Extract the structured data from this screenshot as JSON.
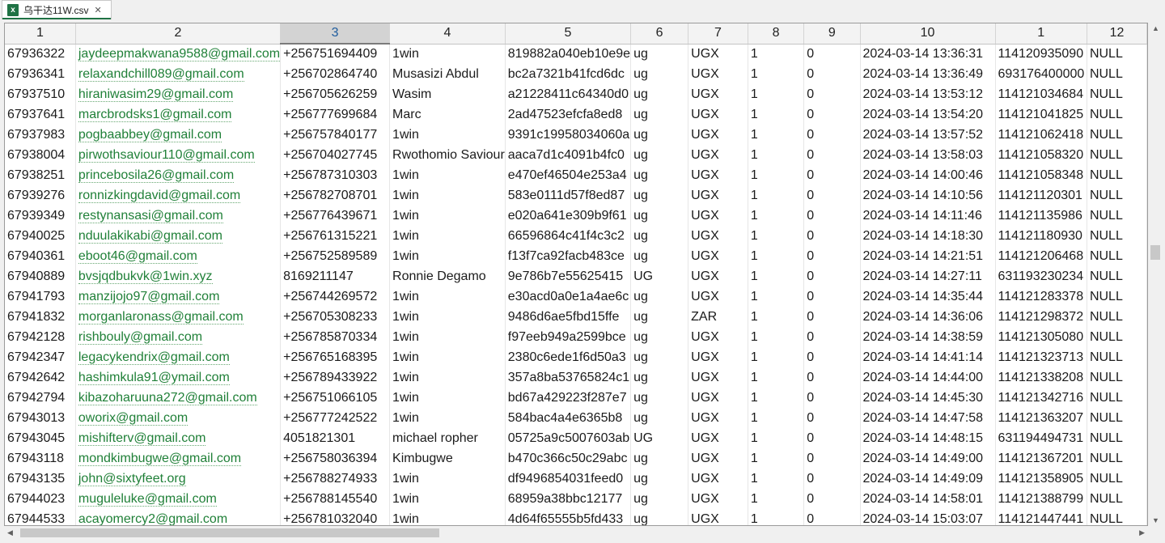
{
  "tab": {
    "title": "乌干达11W.csv",
    "icon": "x",
    "close": "✕"
  },
  "columns": [
    "1",
    "2",
    "3",
    "4",
    "5",
    "6",
    "7",
    "8",
    "9",
    "10",
    "1",
    "12"
  ],
  "rows": [
    [
      "67936322",
      "jaydeepmakwana9588@gmail.com",
      "+256751694409",
      "1win",
      "819882a040eb10e9e",
      "ug",
      "UGX",
      "1",
      "0",
      "2024-03-14 13:36:31",
      "114120935090",
      "NULL"
    ],
    [
      "67936341",
      "relaxandchill089@gmail.com",
      "+256702864740",
      "Musasizi Abdul",
      "bc2a7321b41fcd6dc",
      "ug",
      "UGX",
      "1",
      "0",
      "2024-03-14 13:36:49",
      "693176400000",
      "NULL"
    ],
    [
      "67937510",
      "hiraniwasim29@gmail.com",
      "+256705626259",
      "Wasim",
      "a21228411c64340d0",
      "ug",
      "UGX",
      "1",
      "0",
      "2024-03-14 13:53:12",
      "114121034684",
      "NULL"
    ],
    [
      "67937641",
      "marcbrodsks1@gmail.com",
      "+256777699684",
      "Marc",
      "2ad47523efcfa8ed8",
      "ug",
      "UGX",
      "1",
      "0",
      "2024-03-14 13:54:20",
      "114121041825",
      "NULL"
    ],
    [
      "67937983",
      "pogbaabbey@gmail.com",
      "+256757840177",
      "1win",
      "9391c19958034060a",
      "ug",
      "UGX",
      "1",
      "0",
      "2024-03-14 13:57:52",
      "114121062418",
      "NULL"
    ],
    [
      "67938004",
      "pirwothsaviour110@gmail.com",
      "+256704027745",
      "Rwothomio Saviour",
      "aaca7d1c4091b4fc0",
      "ug",
      "UGX",
      "1",
      "0",
      "2024-03-14 13:58:03",
      "114121058320",
      "NULL"
    ],
    [
      "67938251",
      "princebosila26@gmail.com",
      "+256787310303",
      "1win",
      "e470ef46504e253a4",
      "ug",
      "UGX",
      "1",
      "0",
      "2024-03-14 14:00:46",
      "114121058348",
      "NULL"
    ],
    [
      "67939276",
      "ronnizkingdavid@gmail.com",
      "+256782708701",
      "1win",
      "583e0111d57f8ed87",
      "ug",
      "UGX",
      "1",
      "0",
      "2024-03-14 14:10:56",
      "114121120301",
      "NULL"
    ],
    [
      "67939349",
      "restynansasi@gmail.com",
      "+256776439671",
      "1win",
      "e020a641e309b9f61",
      "ug",
      "UGX",
      "1",
      "0",
      "2024-03-14 14:11:46",
      "114121135986",
      "NULL"
    ],
    [
      "67940025",
      "nduulakikabi@gmail.com",
      "+256761315221",
      "1win",
      "66596864c41f4c3c2",
      "ug",
      "UGX",
      "1",
      "0",
      "2024-03-14 14:18:30",
      "114121180930",
      "NULL"
    ],
    [
      "67940361",
      "eboot46@gmail.com",
      "+256752589589",
      "1win",
      "f13f7ca92facb483ce",
      "ug",
      "UGX",
      "1",
      "0",
      "2024-03-14 14:21:51",
      "114121206468",
      "NULL"
    ],
    [
      "67940889",
      "bvsjqdbukvk@1win.xyz",
      "8169211147",
      "Ronnie Degamo",
      "9e786b7e55625415",
      "UG",
      "UGX",
      "1",
      "0",
      "2024-03-14 14:27:11",
      "631193230234",
      "NULL"
    ],
    [
      "67941793",
      "manzijojo97@gmail.com",
      "+256744269572",
      "1win",
      "e30acd0a0e1a4ae6c",
      "ug",
      "UGX",
      "1",
      "0",
      "2024-03-14 14:35:44",
      "114121283378",
      "NULL"
    ],
    [
      "67941832",
      "morganlaronass@gmail.com",
      "+256705308233",
      "1win",
      "9486d6ae5fbd15ffe",
      "ug",
      "ZAR",
      "1",
      "0",
      "2024-03-14 14:36:06",
      "114121298372",
      "NULL"
    ],
    [
      "67942128",
      "rishbouly@gmail.com",
      "+256785870334",
      "1win",
      "f97eeb949a2599bce",
      "ug",
      "UGX",
      "1",
      "0",
      "2024-03-14 14:38:59",
      "114121305080",
      "NULL"
    ],
    [
      "67942347",
      "legacykendrix@gmail.com",
      "+256765168395",
      "1win",
      "2380c6ede1f6d50a3",
      "ug",
      "UGX",
      "1",
      "0",
      "2024-03-14 14:41:14",
      "114121323713",
      "NULL"
    ],
    [
      "67942642",
      "hashimkula91@ymail.com",
      "+256789433922",
      "1win",
      "357a8ba53765824c1",
      "ug",
      "UGX",
      "1",
      "0",
      "2024-03-14 14:44:00",
      "114121338208",
      "NULL"
    ],
    [
      "67942794",
      "kibazoharuuna272@gmail.com",
      "+256751066105",
      "1win",
      "bd67a429223f287e7",
      "ug",
      "UGX",
      "1",
      "0",
      "2024-03-14 14:45:30",
      "114121342716",
      "NULL"
    ],
    [
      "67943013",
      "oworix@gmail.com",
      "+256777242522",
      "1win",
      "584bac4a4e6365b8",
      "ug",
      "UGX",
      "1",
      "0",
      "2024-03-14 14:47:58",
      "114121363207",
      "NULL"
    ],
    [
      "67943045",
      "mishifterv@gmail.com",
      "4051821301",
      "michael ropher",
      "05725a9c5007603ab",
      "UG",
      "UGX",
      "1",
      "0",
      "2024-03-14 14:48:15",
      "631194494731",
      "NULL"
    ],
    [
      "67943118",
      "mondkimbugwe@gmail.com",
      "+256758036394",
      "Kimbugwe",
      "b470c366c50c29abc",
      "ug",
      "UGX",
      "1",
      "0",
      "2024-03-14 14:49:00",
      "114121367201",
      "NULL"
    ],
    [
      "67943135",
      "john@sixtyfeet.org",
      "+256788274933",
      "1win",
      "df9496854031feed0",
      "ug",
      "UGX",
      "1",
      "0",
      "2024-03-14 14:49:09",
      "114121358905",
      "NULL"
    ],
    [
      "67944023",
      "muguleluke@gmail.com",
      "+256788145540",
      "1win",
      "68959a38bbc12177",
      "ug",
      "UGX",
      "1",
      "0",
      "2024-03-14 14:58:01",
      "114121388799",
      "NULL"
    ],
    [
      "67944533",
      "acayomercy2@gmail.com",
      "+256781032040",
      "1win",
      "4d64f65555b5fd433",
      "ug",
      "UGX",
      "1",
      "0",
      "2024-03-14 15:03:07",
      "114121447441",
      "NULL"
    ]
  ],
  "scroll": {
    "up": "▲",
    "down": "▼",
    "left": "◀",
    "right": "▶"
  }
}
